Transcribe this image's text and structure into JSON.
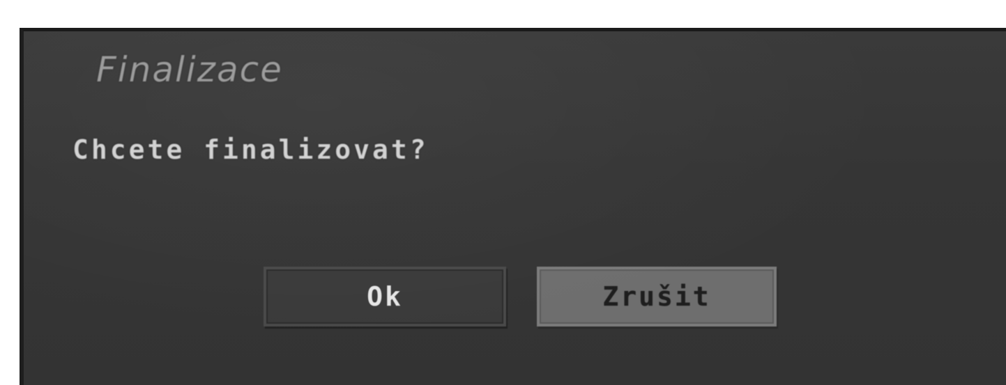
{
  "dialog": {
    "title": "Finalizace",
    "message": "Chcete finalizovat?",
    "buttons": {
      "ok_label": "Ok",
      "cancel_label": "Zrušit"
    },
    "selected_button": "Zrušit"
  },
  "colors": {
    "dialog_background": "#363636",
    "button_default": "#3a3a3a",
    "button_selected": "#6e6e6e",
    "text": "#d2d2d2"
  }
}
